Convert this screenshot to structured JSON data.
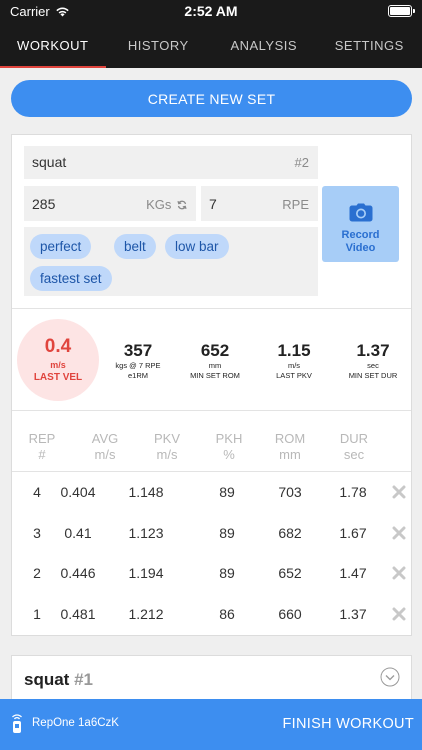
{
  "status": {
    "carrier": "Carrier",
    "time": "2:52 AM"
  },
  "tabs": [
    {
      "label": "WORKOUT",
      "active": true
    },
    {
      "label": "HISTORY"
    },
    {
      "label": "ANALYSIS"
    },
    {
      "label": "SETTINGS"
    }
  ],
  "create_set_label": "CREATE NEW SET",
  "set": {
    "exercise": "squat",
    "set_number": "#2",
    "weight": "285",
    "weight_unit": "KGs",
    "rpe": "7",
    "rpe_label": "RPE",
    "tags": [
      "perfect",
      "belt",
      "low bar",
      "fastest set"
    ],
    "record_label_1": "Record",
    "record_label_2": "Video"
  },
  "stats": {
    "last_vel": {
      "value": "0.4",
      "unit": "m/s",
      "label": "LAST VEL"
    },
    "e1rm": {
      "value": "357",
      "unit": "kgs @ 7 RPE",
      "label": "e1RM"
    },
    "min_set_rom": {
      "value": "652",
      "unit": "mm",
      "label": "MIN SET ROM"
    },
    "last_pkv": {
      "value": "1.15",
      "unit": "m/s",
      "label": "LAST PKV"
    },
    "min_set_dur": {
      "value": "1.37",
      "unit": "sec",
      "label": "MIN SET DUR"
    }
  },
  "table": {
    "headers": [
      {
        "top": "REP",
        "bottom": "#"
      },
      {
        "top": "AVG",
        "bottom": "m/s"
      },
      {
        "top": "PKV",
        "bottom": "m/s"
      },
      {
        "top": "PKH",
        "bottom": "%"
      },
      {
        "top": "ROM",
        "bottom": "mm"
      },
      {
        "top": "DUR",
        "bottom": "sec"
      }
    ],
    "rows": [
      {
        "rep": "4",
        "avg": "0.404",
        "pkv": "1.148",
        "pkh": "89",
        "rom": "703",
        "dur": "1.78"
      },
      {
        "rep": "3",
        "avg": "0.41",
        "pkv": "1.123",
        "pkh": "89",
        "rom": "682",
        "dur": "1.67"
      },
      {
        "rep": "2",
        "avg": "0.446",
        "pkv": "1.194",
        "pkh": "89",
        "rom": "652",
        "dur": "1.47"
      },
      {
        "rep": "1",
        "avg": "0.481",
        "pkv": "1.212",
        "pkh": "86",
        "rom": "660",
        "dur": "1.37"
      }
    ]
  },
  "previous_set": {
    "exercise": "squat",
    "number": "#1"
  },
  "bottom": {
    "device": "RepOne 1a6CzK",
    "finish_label": "FINISH WORKOUT"
  },
  "colors": {
    "accent_blue": "#3d8ef0",
    "accent_red": "#e0443d",
    "tag_bg": "#bfd8fa"
  }
}
